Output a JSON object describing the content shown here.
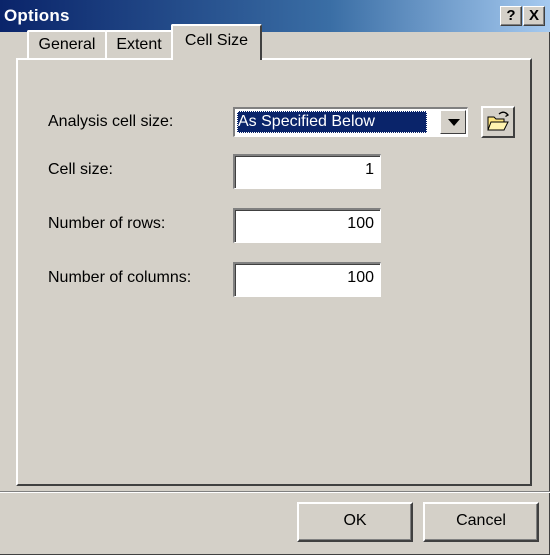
{
  "window": {
    "title": "Options",
    "help_label": "?",
    "close_label": "X"
  },
  "tabs": [
    {
      "label": "General",
      "active": false
    },
    {
      "label": "Extent",
      "active": false
    },
    {
      "label": "Cell Size",
      "active": true
    }
  ],
  "cell_size_panel": {
    "analysis_cell_size": {
      "label": "Analysis cell size:",
      "selected": "As Specified Below",
      "icon": "open-folder-icon"
    },
    "cell_size": {
      "label": "Cell size:",
      "value": "1"
    },
    "number_of_rows": {
      "label": "Number of rows:",
      "value": "100"
    },
    "number_of_columns": {
      "label": "Number of columns:",
      "value": "100"
    }
  },
  "buttons": {
    "ok_label": "OK",
    "cancel_label": "Cancel"
  },
  "colors": {
    "face": "#d4d0c8",
    "title_start": "#0a246a",
    "title_end": "#a6caf0",
    "selection": "#0a246a"
  }
}
